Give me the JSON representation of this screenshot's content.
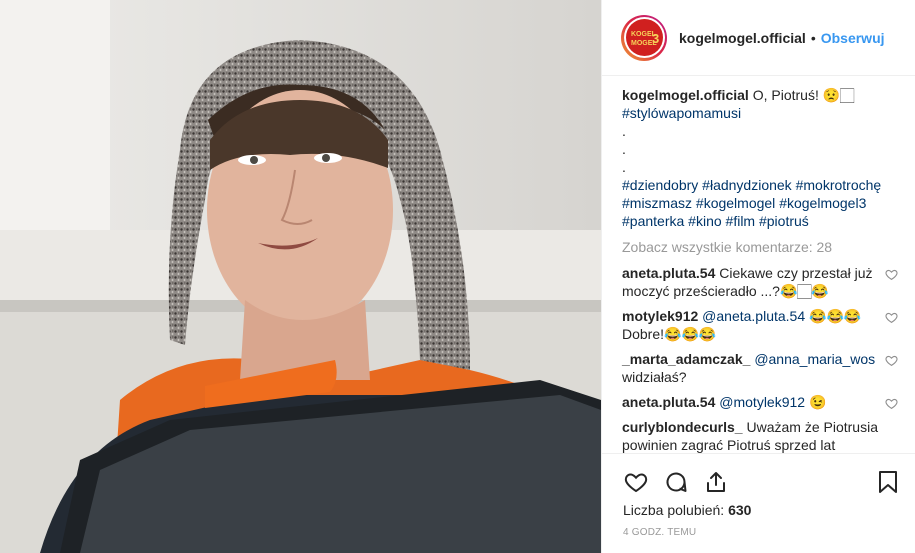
{
  "post": {
    "username": "kogelmogel.official",
    "separator": "•",
    "follow_label": "Obserwuj",
    "avatar_logo_text": "KOGEL MOGEL 3",
    "caption": {
      "username": "kogelmogel.official",
      "text": "O, Piotruś! 😟🏻",
      "hashtag_line1": "#stylówapomamusi",
      "dots": [
        ".",
        ".",
        "."
      ],
      "hashtags": [
        "#dziendobry",
        "#ładnydzionek",
        "#mokrotrochę",
        "#miszmasz",
        "#kogelmogel",
        "#kogelmogel3",
        "#panterka",
        "#kino",
        "#film",
        "#piotruś"
      ]
    },
    "view_all_comments": "Zobacz wszystkie komentarze: 28",
    "comments": [
      {
        "user": "aneta.pluta.54",
        "mention": "",
        "text": "Ciekawe czy przestał już moczyć prześcieradło ...?😂🏻😂"
      },
      {
        "user": "motylek912",
        "mention": "@aneta.pluta.54",
        "text": "😂😂😂 Dobre!😂😂😂"
      },
      {
        "user": "_marta_adamczak_",
        "mention": "@anna_maria_wos",
        "text": "widziałaś?"
      },
      {
        "user": "aneta.pluta.54",
        "mention": "@motylek912",
        "text": "😉"
      },
      {
        "user": "curlyblondecurls_",
        "mention": "",
        "text": "Uważam że Piotrusia powinien zagrać Piotruś sprzed lat"
      }
    ],
    "likes_label": "Liczba polubień:",
    "likes_count": "630",
    "time_ago": "4 GODZ. TEMU"
  },
  "icons": {
    "like": "heart-icon",
    "comment": "comment-icon",
    "share": "share-icon",
    "save": "bookmark-icon",
    "comment_like": "heart-small-icon"
  },
  "colors": {
    "link": "#3897f0",
    "hashtag": "#003569",
    "muted": "#999999",
    "avatar_bg": "#d0201f"
  }
}
